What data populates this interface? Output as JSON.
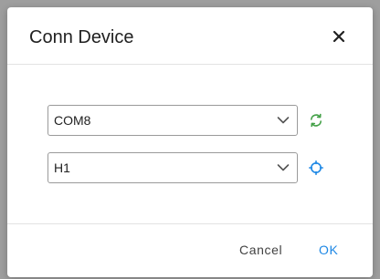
{
  "dialog": {
    "title": "Conn Device",
    "close_icon": "close-icon",
    "port_select": {
      "value": "COM8",
      "icon": "chevron-down-icon"
    },
    "port_refresh_icon": {
      "icon": "refresh-icon",
      "color": "#43a047"
    },
    "device_select": {
      "value": "H1",
      "icon": "chevron-down-icon"
    },
    "device_scan_icon": {
      "icon": "scan-target-icon",
      "color": "#1e88e5"
    },
    "cancel_label": "Cancel",
    "ok_label": "OK",
    "accent_color": "#1e88e5"
  }
}
